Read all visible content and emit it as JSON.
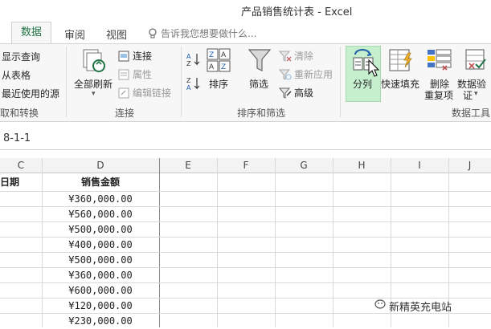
{
  "window": {
    "title": "产品销售统计表 - Excel"
  },
  "tabs": {
    "data": "数据",
    "review": "审阅",
    "view": "视图",
    "tell_me": "告诉我您想要做什么..."
  },
  "ribbon": {
    "get_transform": {
      "items": [
        "显示查询",
        "从表格",
        "最近使用的源"
      ],
      "group_label": "取和转换"
    },
    "connections": {
      "refresh_all": "全部刷新",
      "connections": "连接",
      "properties": "属性",
      "edit_links": "编辑链接",
      "group_label": "连接"
    },
    "sort_filter": {
      "sort": "排序",
      "filter": "筛选",
      "clear": "清除",
      "reapply": "重新应用",
      "advanced": "高级",
      "group_label": "排序和筛选"
    },
    "data_tools": {
      "text_to_columns": "分列",
      "flash_fill": "快速填充",
      "remove_duplicates_line1": "删除",
      "remove_duplicates_line2": "重复项",
      "validation_line1": "数据验",
      "validation_line2": "证",
      "group_label": "数据工具"
    }
  },
  "formula_bar": {
    "value": "8-1-1"
  },
  "columns": [
    "C",
    "D",
    "E",
    "F",
    "G",
    "H",
    "I",
    "J"
  ],
  "header_row": {
    "c": "日期",
    "d": "销售金额"
  },
  "sales_amounts": [
    "¥360,000.00",
    "¥560,000.00",
    "¥500,000.00",
    "¥400,000.00",
    "¥500,000.00",
    "¥360,000.00",
    "¥600,000.00",
    "¥120,000.00",
    "¥230,000.00"
  ],
  "watermark": "新精英充电站",
  "colors": {
    "accent": "#217346",
    "selected_button": "#c6efce"
  }
}
